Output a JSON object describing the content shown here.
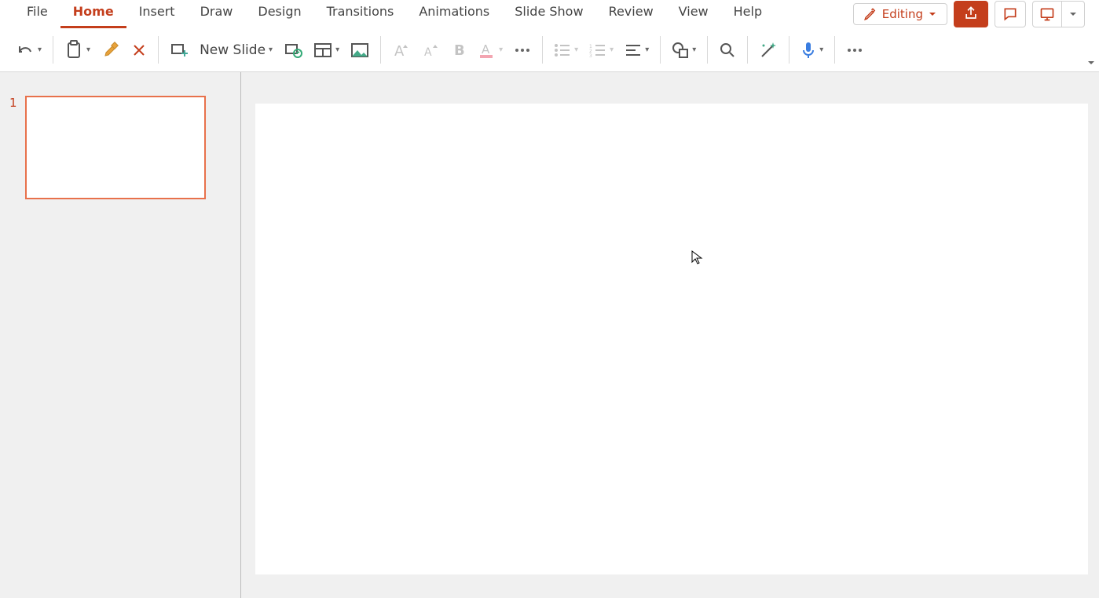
{
  "tabs": {
    "file": "File",
    "home": "Home",
    "insert": "Insert",
    "draw": "Draw",
    "design": "Design",
    "transitions": "Transitions",
    "animations": "Animations",
    "slideshow": "Slide Show",
    "review": "Review",
    "view": "View",
    "help": "Help",
    "active": "home"
  },
  "mode": {
    "label": "Editing"
  },
  "toolbar": {
    "new_slide_label": "New Slide"
  },
  "sidebar": {
    "slides": [
      {
        "index": "1"
      }
    ]
  },
  "icons": {
    "pencil": "pencil",
    "share": "share",
    "comment": "comment",
    "present": "present",
    "chevron_down": "▾"
  },
  "colors": {
    "accent": "#c43e1c",
    "underline": "#e8714b"
  }
}
